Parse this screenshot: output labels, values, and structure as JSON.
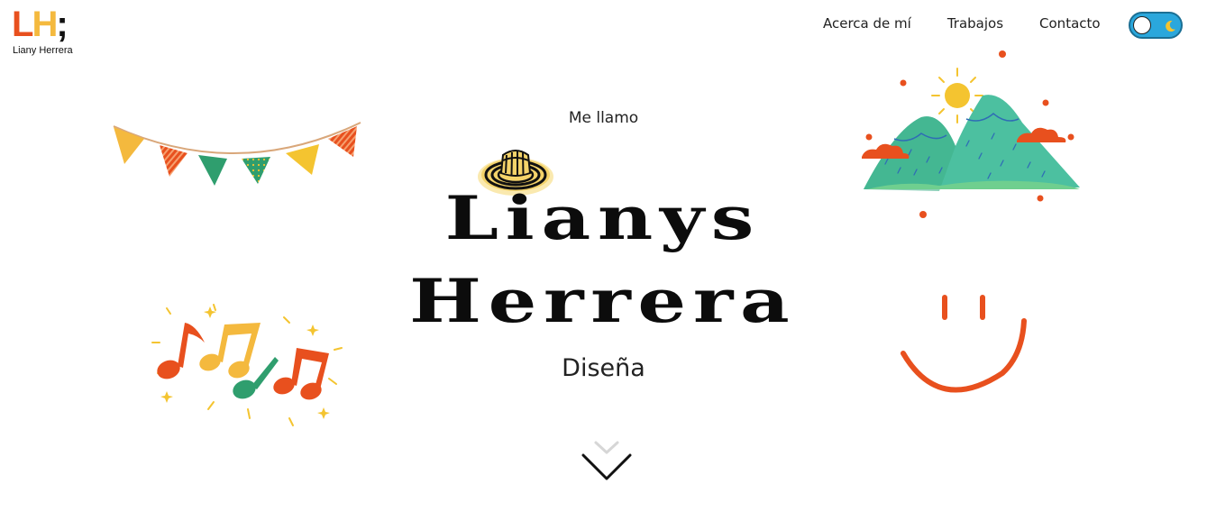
{
  "header": {
    "logo": {
      "letter_l": "L",
      "letter_h": "H",
      "semicolon": ";",
      "name": "Liany Herrera"
    },
    "nav": [
      {
        "label": "Acerca de mí"
      },
      {
        "label": "Trabajos"
      },
      {
        "label": "Contacto"
      }
    ],
    "theme_toggle": {
      "state": "light",
      "icon": "moon-icon"
    }
  },
  "hero": {
    "greeting": "Me llamo",
    "first_name": "Lianys",
    "last_name": "Herrera",
    "role": "Diseña",
    "scroll_icon": "chevron-down-icon"
  },
  "illustrations": [
    "bunting-icon",
    "sombrero-vueltiao-icon",
    "mountains-sun-icon",
    "music-notes-icon",
    "smiley-icon"
  ],
  "colors": {
    "orange": "#e8501e",
    "yellow": "#f4b93e",
    "green": "#2f9e6e",
    "teal": "#4cc0a0",
    "toggle_blue": "#2aa7dc",
    "text": "#111111"
  }
}
